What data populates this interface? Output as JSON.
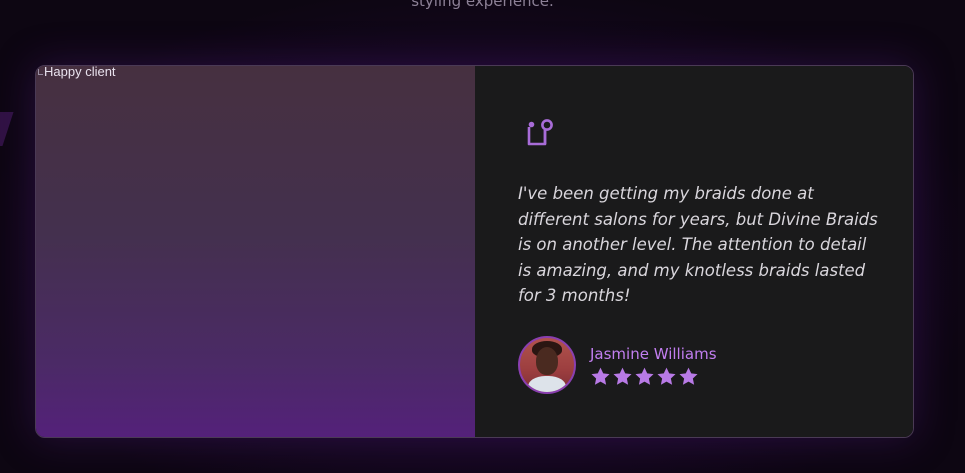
{
  "header": {
    "subtitle": "styling experience."
  },
  "testimonial": {
    "image_alt": "Happy client",
    "quote_icon": "quote-icon",
    "quote": "I've been getting my braids done at different salons for years, but Divine Braids is on another level. The attention to detail is amazing, and my knotless braids lasted for 3 months!",
    "author_name": "Jasmine Williams",
    "rating": 5,
    "rating_max": 5,
    "star_icon": "star-icon"
  },
  "colors": {
    "accent": "#c27ef0",
    "icon": "#a86cd8",
    "star": "#b87ae6",
    "card_text_bg": "#1a1a1b",
    "quote_text": "#d9d6dc"
  }
}
